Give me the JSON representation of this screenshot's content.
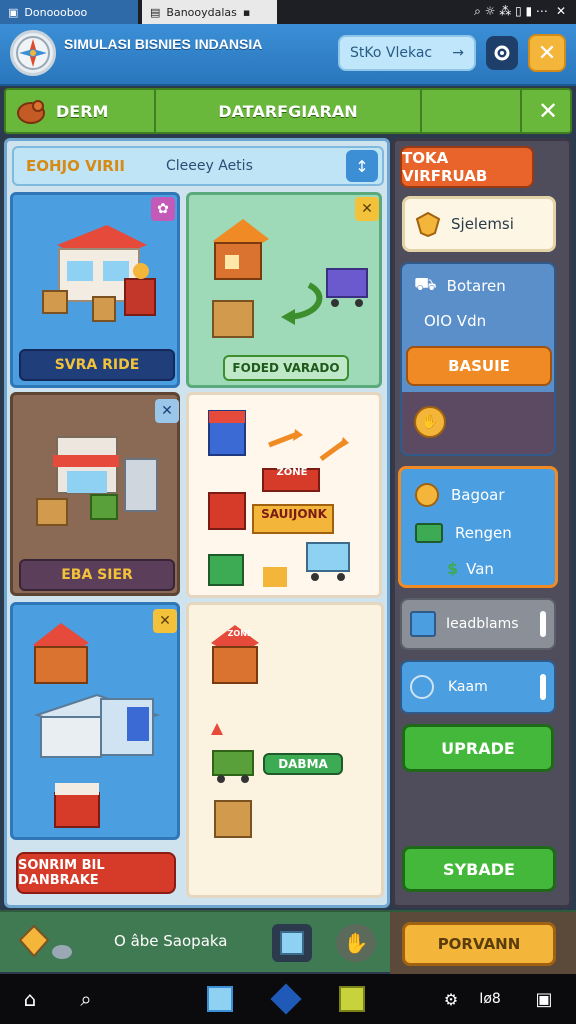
{
  "statusbar": {
    "tab1_label": "Donoooboo",
    "tab2_label": "Banooydalas",
    "right_text": "⌕ ☼ ⁂ ▯ ▮ ⋯"
  },
  "header": {
    "title": "SIMULASI BISNIES INDANSIA",
    "search_label": "StKo Vlekac",
    "search_arrow": "→",
    "settings_icon": "gear-icon",
    "close_label": "✕"
  },
  "navbar": {
    "tab1": "DERM",
    "tab2": "DATARFGIARAN",
    "close_label": "✕"
  },
  "board": {
    "title": "EOHJO VIRII",
    "subtitle": "Cleeey Aetis",
    "action_icon": "↕",
    "cards": {
      "store_label": "SVRA RIDE",
      "food_label": "FODED VARADO",
      "shop_label": "EBA SIER",
      "market_sign1": "ZONE",
      "market_sign2": "SAUIJONK",
      "bottom_button": "SONRIM BIL DANBRAKE",
      "cart_badge": "DABMA",
      "kiosk_sign": "ZONE"
    }
  },
  "sidebar": {
    "top_button": "TOKA VIRFRUAB",
    "select_label": "Sjelemsi",
    "info_title": "Botaren",
    "info_value": "OIO Vdn",
    "basic_button": "BASUIE",
    "stat1": "Bagoar",
    "stat2": "Rengen",
    "stat3": "Van",
    "slot1": "Ieadblams",
    "slot2": "Kaam",
    "upgrade_button": "UPRADE",
    "secondary_button": "SYBADE",
    "bottom_button": "PORVANN"
  },
  "bottombar": {
    "label": "O âbe Saopaka"
  },
  "taskbar": {
    "right_label": "Ico",
    "time": "Iø8"
  },
  "colors": {
    "green": "#69b83b",
    "orange": "#f08a24",
    "blue": "#3c8fd4",
    "red": "#d63b2a"
  }
}
